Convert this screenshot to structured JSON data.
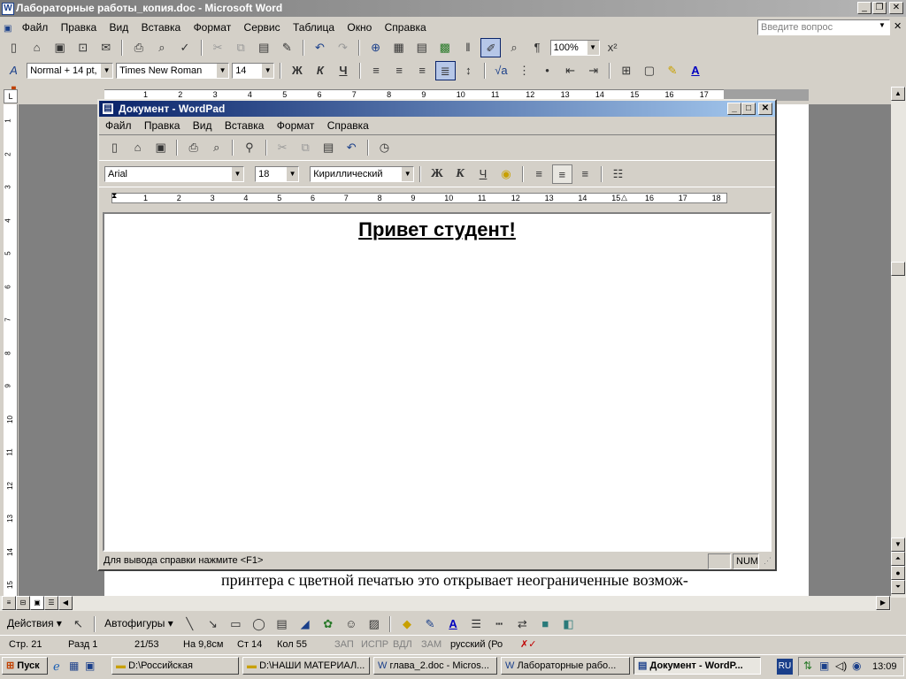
{
  "word": {
    "title": "Лабораторные работы_копия.doc - Microsoft Word",
    "menu": [
      "Файл",
      "Правка",
      "Вид",
      "Вставка",
      "Формат",
      "Сервис",
      "Таблица",
      "Окно",
      "Справка"
    ],
    "help_placeholder": "Введите вопрос",
    "zoom": "100%",
    "style": "Normal + 14 pt, r",
    "font": "Times New Roman",
    "size": "14",
    "body_text": "принтера с цветной печатью это открывает неограниченные возмож-",
    "draw_actions": "Действия",
    "draw_autoshapes": "Автофигуры",
    "status": {
      "page": "Стр. 21",
      "section": "Разд 1",
      "pages": "21/53",
      "at": "На 9,8см",
      "line": "Ст 14",
      "col": "Кол 55",
      "rec": "ЗАП",
      "trk": "ИСПР",
      "ext": "ВДЛ",
      "ovr": "ЗАМ",
      "lang": "русский (Ро"
    },
    "hruler": [
      "1",
      "2",
      "3",
      "4",
      "5",
      "6",
      "7",
      "8",
      "9",
      "10",
      "11",
      "12",
      "13",
      "14",
      "15",
      "16",
      "17"
    ],
    "vruler": [
      "1",
      "2",
      "3",
      "4",
      "5",
      "6",
      "7",
      "8",
      "9",
      "10",
      "11",
      "12",
      "13",
      "14",
      "15",
      "16"
    ]
  },
  "wordpad": {
    "title": "Документ - WordPad",
    "menu": [
      "Файл",
      "Правка",
      "Вид",
      "Вставка",
      "Формат",
      "Справка"
    ],
    "font": "Arial",
    "size": "18",
    "script": "Кириллический",
    "bold": "Ж",
    "italic": "К",
    "underline": "Ч",
    "document_text": "Привет студент!",
    "status_help": "Для вывода справки нажмите <F1>",
    "status_num": "NUM",
    "ruler": [
      "1",
      "2",
      "3",
      "4",
      "5",
      "6",
      "7",
      "8",
      "9",
      "10",
      "11",
      "12",
      "13",
      "14",
      "15",
      "16",
      "17",
      "18"
    ]
  },
  "taskbar": {
    "start": "Пуск",
    "tasks": [
      "D:\\Российская",
      "D:\\НАШИ МАТЕРИАЛ...",
      "глава_2.doc - Micros...",
      "Лабораторные рабо...",
      "Документ - WordP..."
    ],
    "lang": "RU",
    "clock": "13:09"
  }
}
